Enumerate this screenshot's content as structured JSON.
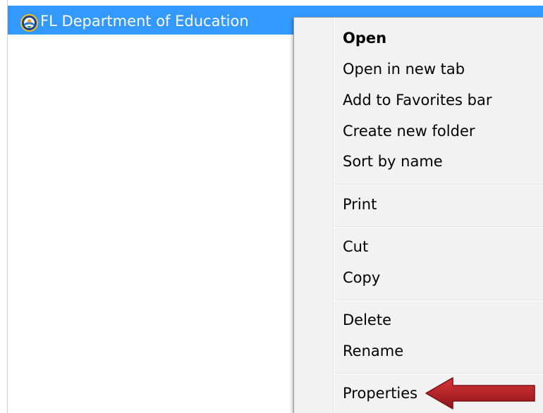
{
  "favorite": {
    "label": "FL Department of Education",
    "icon": "fl-doe-seal-icon"
  },
  "context_menu": {
    "items": [
      {
        "label": "Open",
        "bold": true
      },
      {
        "label": "Open in new tab"
      },
      {
        "label": "Add to Favorites bar"
      },
      {
        "label": "Create new folder"
      },
      {
        "label": "Sort by name"
      },
      {
        "label": "Print"
      },
      {
        "label": "Cut"
      },
      {
        "label": "Copy"
      },
      {
        "label": "Delete"
      },
      {
        "label": "Rename"
      },
      {
        "label": "Properties"
      }
    ]
  },
  "annotation": {
    "arrow_color": "#b52025",
    "points_to": "Properties"
  },
  "colors": {
    "selection": "#3399ff",
    "menu_bg": "#f2f2f2"
  }
}
